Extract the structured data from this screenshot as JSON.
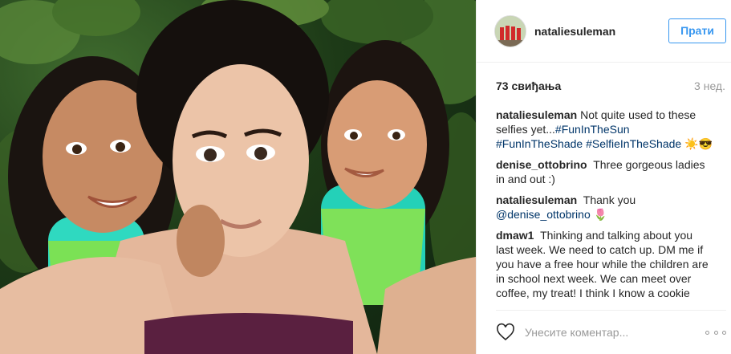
{
  "post": {
    "username": "nataliesuleman",
    "follow_label": "Прати",
    "likes": "73 свиђања",
    "age": "3 нед."
  },
  "comments": [
    {
      "user": "nataliesuleman",
      "text": "Not quite used to these selfies yet...",
      "links": [
        "#FunInTheSun",
        "#FunInTheShade",
        "#SelfieInTheShade"
      ],
      "emoji": "☀️😎"
    },
    {
      "user": "denise_ottobrino",
      "text": "Three gorgeous ladies in and out :)"
    },
    {
      "user": "nataliesuleman",
      "text": "Thank you",
      "mention": "@denise_ottobrino",
      "emoji": "🌷"
    },
    {
      "user": "dmaw1",
      "text": "Thinking and talking about you last week. We need to catch up. DM me if you have a free hour while the children are in school next week. We can meet over coffee, my treat! I think I know a cookie"
    }
  ],
  "footer": {
    "placeholder": "Унесите коментар..."
  },
  "icons": {
    "like": "heart-icon",
    "more": "ellipsis-icon"
  },
  "colors": {
    "accent": "#3897f0",
    "link": "#003569",
    "muted": "#999999",
    "border": "#efefef"
  }
}
